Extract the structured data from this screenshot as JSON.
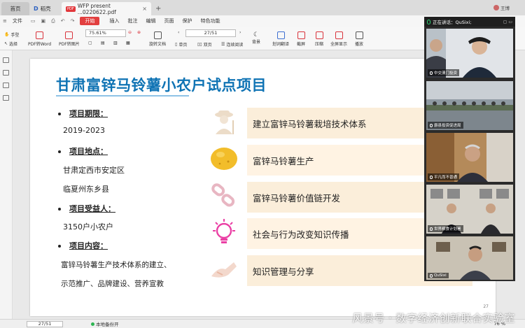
{
  "tabs": {
    "home": "首页",
    "draft": "稻壳",
    "draft_logo": "D",
    "active": "WFP present ...0220622.pdf",
    "pdf_badge": "PDF",
    "close": "×",
    "add": "+"
  },
  "user": {
    "name": "王博"
  },
  "menu": {
    "file": "文件",
    "start": "开始",
    "insert": "插入",
    "annotate": "批注",
    "edit": "编辑",
    "page": "页面",
    "protect": "保护",
    "features": "特色功能"
  },
  "ribbon": {
    "hand": "手型",
    "select": "选择",
    "pdf2word": "PDF转Word",
    "pdf2img": "PDF转图片",
    "zoom": "75.61%",
    "rotate": "旋转文档",
    "page_indicator": "27/51",
    "single": "单页",
    "double": "双页",
    "continuous": "连续阅读",
    "background": "背景",
    "translate": "划词翻译",
    "screenshot": "截屏",
    "compress": "压缩",
    "fullscreen": "全屏显示",
    "play": "播放"
  },
  "slide": {
    "title": "甘肃富锌马铃薯小农户试点项目",
    "period_label": "项目期限：",
    "period": "2019-2023",
    "location_label": "项目地点：",
    "location_1": "甘肃定西市安定区",
    "location_2": "临夏州东乡县",
    "beneficiary_label": "项目受益人：",
    "beneficiary": "3150户小农户",
    "content_label": "项目内容：",
    "content_1": "富锌马铃薯生产技术体系的建立、",
    "content_2": "示范推广、品牌建设、营养宣教",
    "items": [
      "建立富锌马铃薯栽培技术体系",
      "富锌马铃薯生产",
      "富锌马铃薯价值链开发",
      "社会与行为改变知识传播",
      "知识管理与分享"
    ],
    "page_num": "27"
  },
  "meeting": {
    "speaking": "正在讲话：QuSixi;",
    "participants": [
      "中交澳门投资",
      "爵县投资促进局",
      "平凡而不普通",
      "世界粮食计划署",
      "QuSixi"
    ]
  },
  "status": {
    "page": "27/51",
    "saved": "本地备份开",
    "zoom": "76 %"
  },
  "watermark": "风景号 · 数字经济创新联合实验室",
  "colors": {
    "title": "#0f73b4",
    "band": "#fbeeda",
    "accent": "#e23f3f"
  }
}
